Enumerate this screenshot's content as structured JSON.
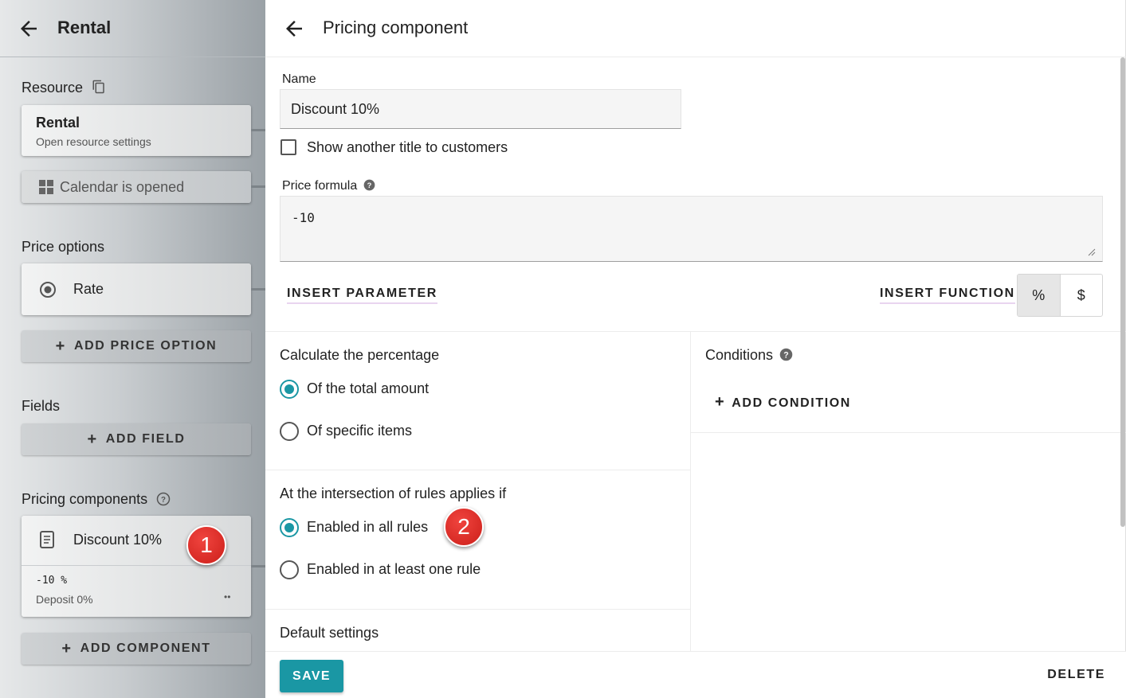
{
  "left_panel": {
    "title": "Rental",
    "resource_label": "Resource",
    "resource_card": {
      "title": "Rental",
      "subtitle": "Open resource settings"
    },
    "calendar_label": "Calendar is opened",
    "price_options_label": "Price options",
    "price_option": {
      "label": "Rate"
    },
    "add_price_option_label": "ADD PRICE OPTION",
    "fields_label": "Fields",
    "add_field_label": "ADD FIELD",
    "pricing_components_label": "Pricing components",
    "component_card": {
      "title": "Discount 10%",
      "value": "-10 %",
      "deposit": "Deposit 0%",
      "more": "••"
    },
    "add_component_label": "ADD COMPONENT"
  },
  "badges": {
    "first": "1",
    "second": "2",
    "color": "#e02a25"
  },
  "right_panel": {
    "title": "Pricing component",
    "name_label": "Name",
    "name_value": "Discount 10%",
    "show_title_label": "Show another title to customers",
    "show_title_checked": false,
    "price_formula_label": "Price formula",
    "price_formula_value": "-10",
    "insert_parameter_label": "INSERT PARAMETER",
    "insert_function_label": "INSERT FUNCTION",
    "unit_toggle": {
      "options": [
        "%",
        "$"
      ],
      "selected": "%"
    },
    "calc_section": {
      "heading": "Calculate the percentage",
      "options": [
        "Of the total amount",
        "Of specific items"
      ],
      "selected": "Of the total amount"
    },
    "intersection_section": {
      "heading": "At the intersection of rules applies if",
      "options": [
        "Enabled in all rules",
        "Enabled in at least one rule"
      ],
      "selected": "Enabled in all rules"
    },
    "default_settings_label": "Default settings",
    "conditions_label": "Conditions",
    "add_condition_label": "ADD CONDITION",
    "save_label": "SAVE",
    "delete_label": "DELETE"
  },
  "colors": {
    "accent": "#1a97a4"
  }
}
